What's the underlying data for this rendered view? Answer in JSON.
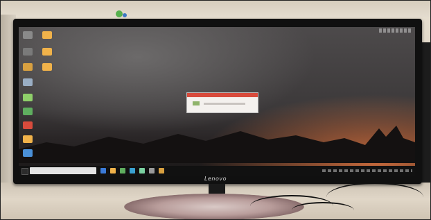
{
  "photo": {
    "subject": "monitor-on-desk",
    "monitor": {
      "brand_text": "Lenovo"
    },
    "desktop": {
      "icon_colors": [
        "#f0b24a",
        "#f0b24a",
        "#f0b24a",
        "#5aa0d8",
        "#8fcf6a",
        "#d84b3c",
        "#f0b24a",
        "#4a90d8"
      ],
      "accent_sunset": "#c76a3c",
      "dialog_title_color": "#d84b3c",
      "taskbar_icon_colors": [
        "#3b7bd8",
        "#f0b24a",
        "#5fae5f",
        "#3aa1d1",
        "#7ad1a0",
        "#9a9a9a",
        "#d8a040"
      ]
    }
  }
}
